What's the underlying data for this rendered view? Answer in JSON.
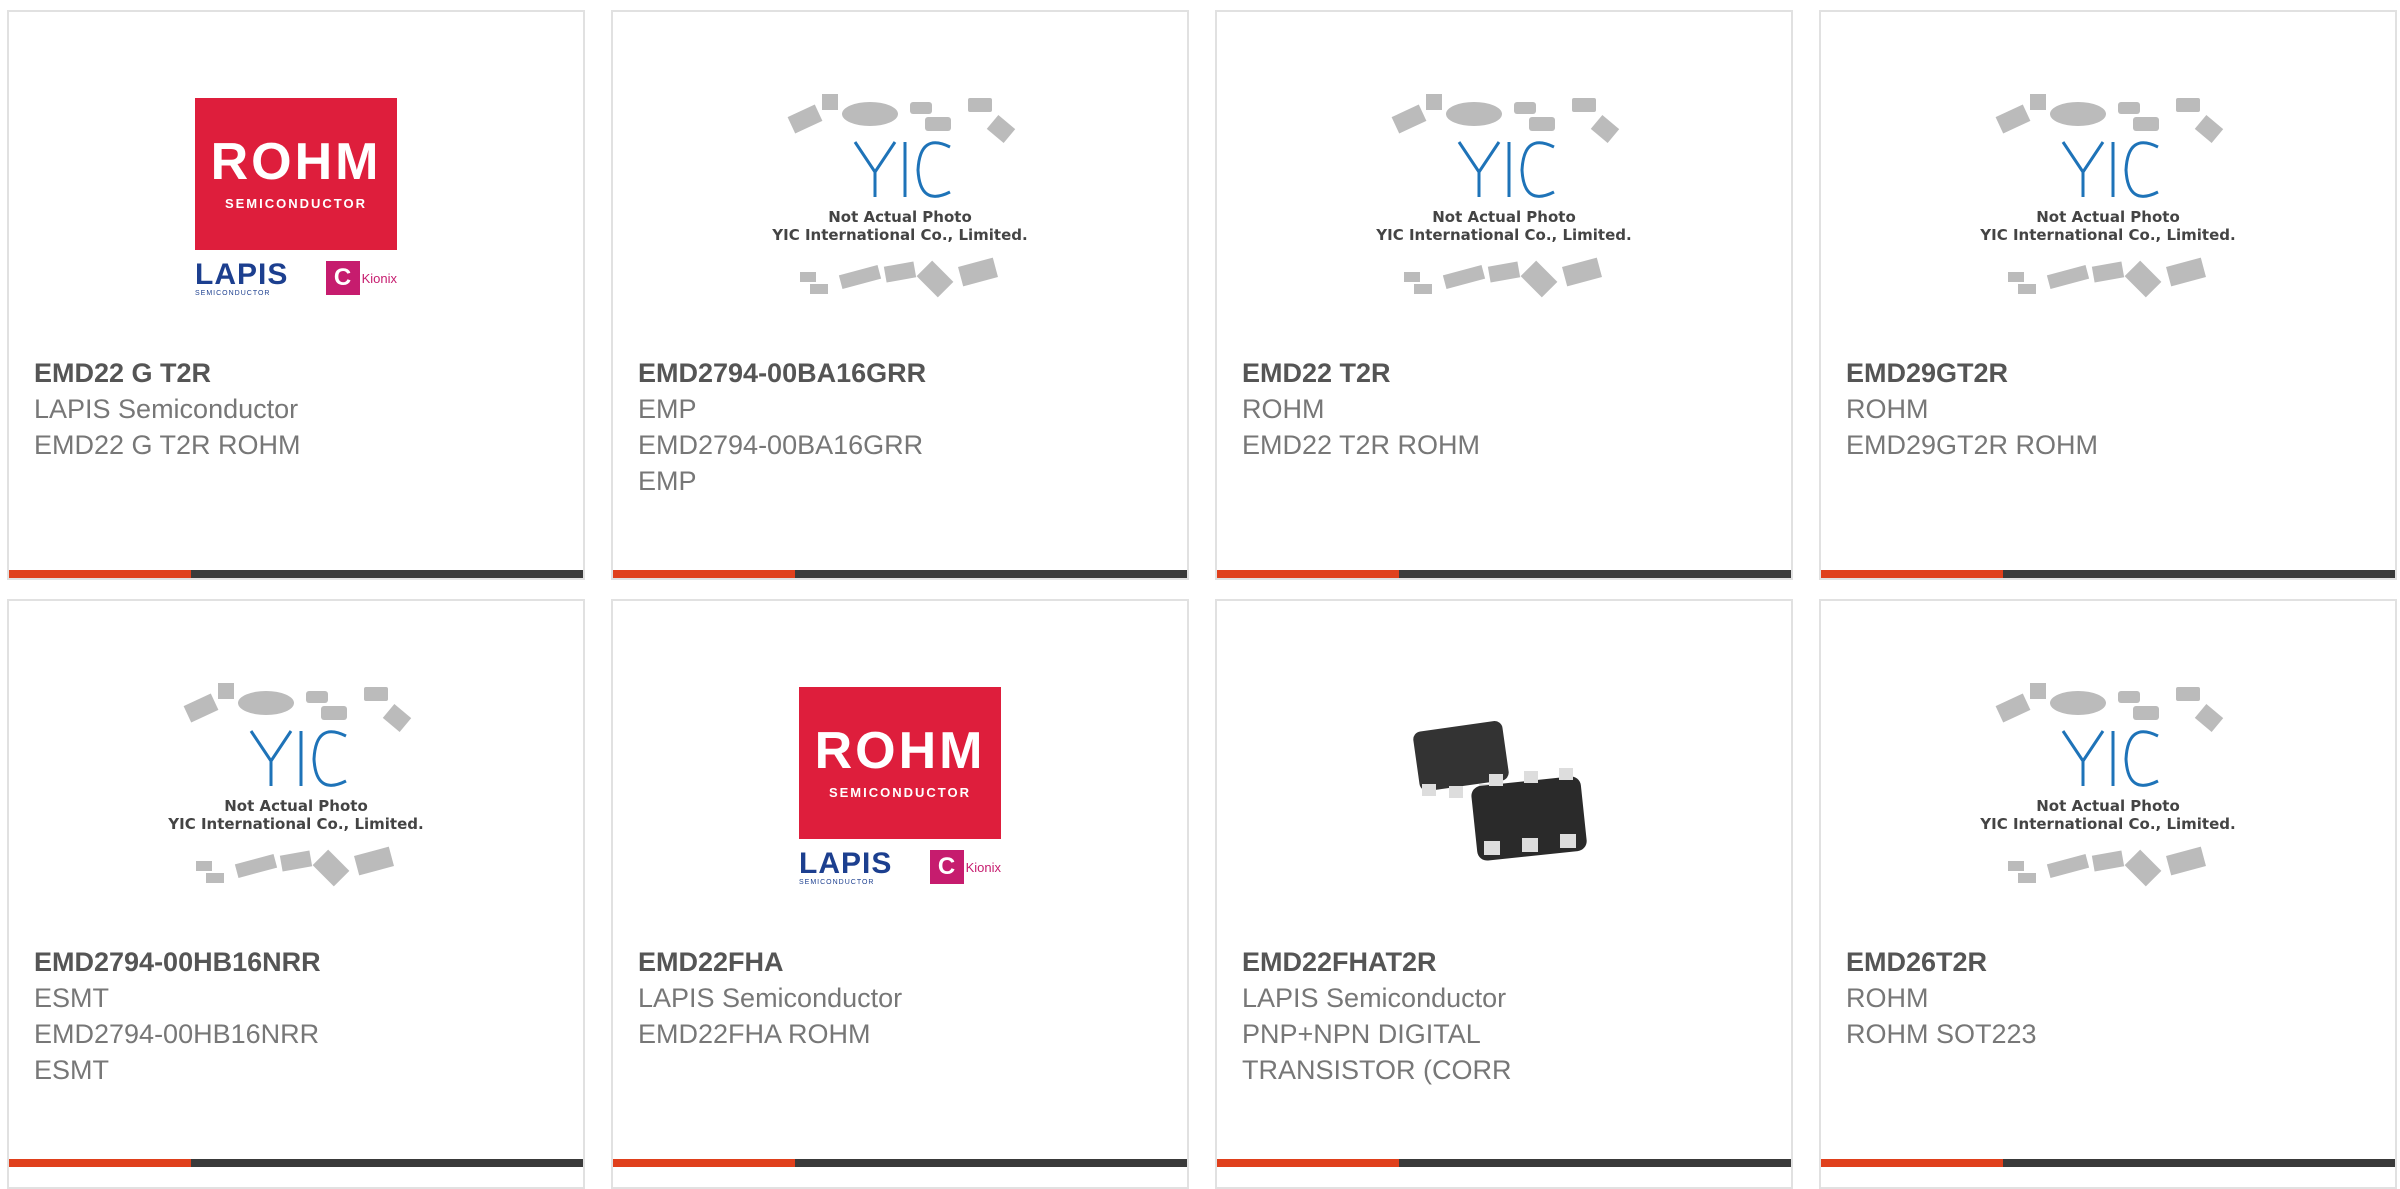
{
  "products": [
    {
      "part_number": "EMD22 G T2R",
      "manufacturer": "LAPIS Semiconductor",
      "description": "EMD22 G T2R ROHM",
      "image": "rohm-lapis-logo"
    },
    {
      "part_number": "EMD2794-00BA16GRR",
      "manufacturer": "EMP",
      "description": "EMD2794-00BA16GRR EMP",
      "image": "yic-placeholder"
    },
    {
      "part_number": "EMD22 T2R",
      "manufacturer": "ROHM",
      "description": "EMD22 T2R ROHM",
      "image": "yic-placeholder"
    },
    {
      "part_number": "EMD29GT2R",
      "manufacturer": "ROHM",
      "description": "EMD29GT2R ROHM",
      "image": "yic-placeholder"
    },
    {
      "part_number": "EMD2794-00HB16NRR",
      "manufacturer": "ESMT",
      "description": "EMD2794-00HB16NRR ESMT",
      "image": "yic-placeholder"
    },
    {
      "part_number": "EMD22FHA",
      "manufacturer": "LAPIS Semiconductor",
      "description": "EMD22FHA ROHM",
      "image": "rohm-lapis-logo"
    },
    {
      "part_number": "EMD22FHAT2R",
      "manufacturer": "LAPIS Semiconductor",
      "description": "PNP+NPN DIGITAL TRANSISTOR (CORR",
      "image": "sot-package-photo"
    },
    {
      "part_number": "EMD26T2R",
      "manufacturer": "ROHM",
      "description": "ROHM SOT223",
      "image": "yic-placeholder"
    }
  ],
  "logo": {
    "rohm": "ROHM",
    "rohm_sub": "SEMICONDUCTOR",
    "lapis": "LAPIS",
    "lapis_sub": "SEMICONDUCTOR",
    "kionix": "Kionix"
  },
  "placeholder": {
    "logo_text": "YIC",
    "line1": "Not Actual Photo",
    "line2": "YIC International Co., Limited."
  },
  "colors": {
    "accent": "#e0401c",
    "bar": "#3a3a3a",
    "rohm_red": "#de1e3c",
    "yic_blue": "#1e73b8",
    "lapis_blue": "#1c3f8f"
  }
}
